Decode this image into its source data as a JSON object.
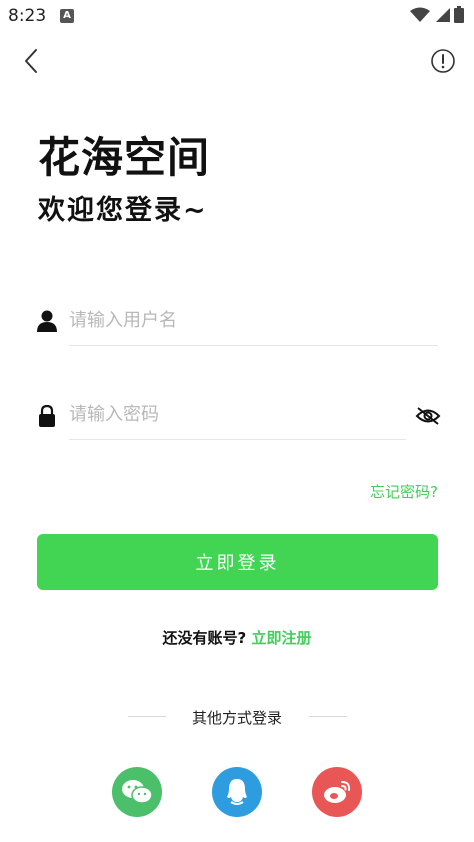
{
  "status_bar": {
    "time": "8:23",
    "notification_letter": "A",
    "icons": [
      "wifi-icon",
      "signal-icon",
      "battery-icon"
    ]
  },
  "header": {
    "back_icon": "chevron-left-icon",
    "info_icon": "info-circle-icon"
  },
  "branding": {
    "app_title": "花海空间",
    "welcome": "欢迎您登录~"
  },
  "form": {
    "username_placeholder": "请输入用户名",
    "username_value": "",
    "password_placeholder": "请输入密码",
    "password_value": "",
    "forgot_password": "忘记密码?",
    "login_button": "立即登录"
  },
  "register": {
    "prompt": "还没有账号?",
    "link": "立即注册"
  },
  "social_login": {
    "label": "其他方式登录",
    "providers": [
      {
        "name": "wechat-icon",
        "color": "#4cbf6b"
      },
      {
        "name": "qq-icon",
        "color": "#2d9de0"
      },
      {
        "name": "weibo-icon",
        "color": "#e85656"
      }
    ]
  },
  "colors": {
    "accent": "#41d553",
    "link": "#3fcf5a"
  }
}
